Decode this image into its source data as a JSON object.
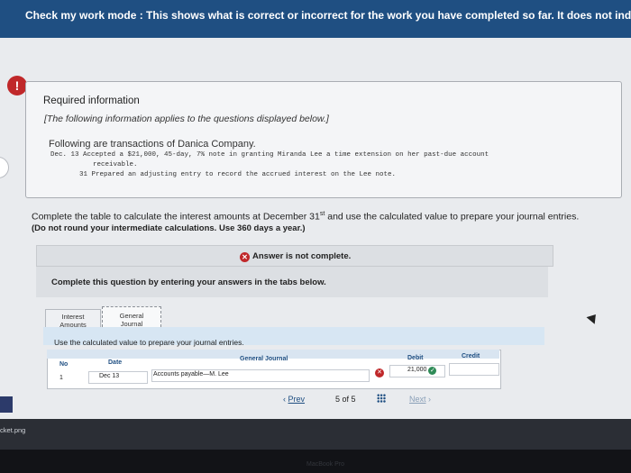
{
  "banner": {
    "text": "Check my work mode : This shows what is correct or incorrect for the work you have completed so far. It does not indicate comp"
  },
  "alert_icon": "!",
  "info": {
    "required": "Required information",
    "applies": "[The following information applies to the questions displayed below.]",
    "transactions_intro": "Following are transactions of Danica Company.",
    "line1": "Dec. 13 Accepted a $21,000, 45-day, 7% note in granting Miranda Lee a time extension on her past-due account",
    "line1b": "receivable.",
    "line2": "31 Prepared an adjusting entry to record the accrued interest on the Lee note."
  },
  "question": {
    "text_before": "Complete the table to calculate the interest amounts at December 31",
    "sup": "st",
    "text_after": " and use the calculated value to prepare your journal entries.",
    "note": "(Do not round your intermediate calculations. Use 360 days a year.)"
  },
  "status": {
    "answer": "Answer is not complete.",
    "complete_question": "Complete this question by entering your answers in the tabs below."
  },
  "tabs": {
    "interest": [
      "Interest",
      "Amounts"
    ],
    "journal": [
      "General",
      "Journal"
    ]
  },
  "instruction": "Use the calculated value to prepare your journal entries.",
  "journal": {
    "headers": {
      "no": "No",
      "date": "Date",
      "general": "General Journal",
      "debit": "Debit",
      "credit": "Credit"
    },
    "row": {
      "no": "1",
      "date": "Dec 13",
      "account": "Accounts payable—M. Lee",
      "debit": "21,000"
    }
  },
  "pager": {
    "prev": "Prev",
    "current": "5",
    "of": "of 5",
    "next": "Next"
  },
  "taskbar": {
    "file": "cket.png"
  },
  "bezel": {
    "label": "MacBook Pro"
  },
  "colors": {
    "banner": "#1f4f82",
    "error": "#c0282a",
    "correct": "#2e8b57"
  },
  "icons": [
    "alert-icon",
    "x-circle-icon",
    "check-icon",
    "grid-icon",
    "chevron-left-icon",
    "chevron-right-icon",
    "cursor-icon"
  ]
}
